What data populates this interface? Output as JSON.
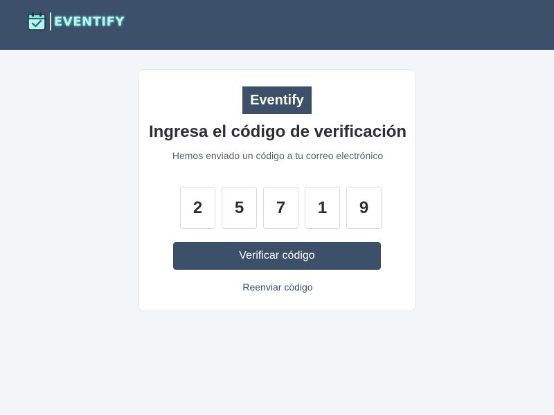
{
  "header": {
    "brand_text": "EVENTIFY",
    "brand_icon": "calendar-check-icon"
  },
  "card": {
    "logo_text": "Eventify",
    "title": "Ingresa el código de verificación",
    "subtitle": "Hemos enviado un código a tu correo electrónico",
    "code_digits": [
      "2",
      "5",
      "7",
      "1",
      "9"
    ],
    "verify_button_label": "Verificar código",
    "resend_link_label": "Reenviar código"
  },
  "colors": {
    "header_bg": "#3d5069",
    "page_bg": "#f4f5f9",
    "accent": "#3d5069",
    "brand_text": "#b8f5f0"
  }
}
